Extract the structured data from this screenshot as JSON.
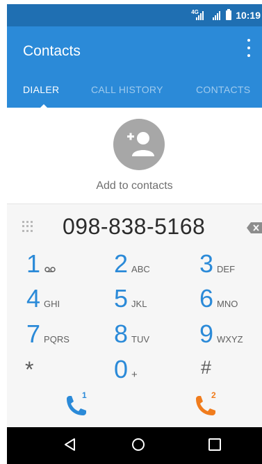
{
  "status_bar": {
    "network_label": "4G",
    "time": "10:19"
  },
  "app_bar": {
    "title": "Contacts",
    "menu_icon": "more-vert-icon"
  },
  "tabs": [
    {
      "label": "DIALER",
      "active": true
    },
    {
      "label": "CALL HISTORY",
      "active": false
    },
    {
      "label": "CONTACTS",
      "active": false
    }
  ],
  "add_contact": {
    "icon": "add-person-icon",
    "label": "Add to contacts"
  },
  "dialer": {
    "number": "098-838-5168",
    "keys": [
      {
        "digit": "1",
        "letters": "voicemail"
      },
      {
        "digit": "2",
        "letters": "ABC"
      },
      {
        "digit": "3",
        "letters": "DEF"
      },
      {
        "digit": "4",
        "letters": "GHI"
      },
      {
        "digit": "5",
        "letters": "JKL"
      },
      {
        "digit": "6",
        "letters": "MNO"
      },
      {
        "digit": "7",
        "letters": "PQRS"
      },
      {
        "digit": "8",
        "letters": "TUV"
      },
      {
        "digit": "9",
        "letters": "WXYZ"
      },
      {
        "digit": "*",
        "letters": ""
      },
      {
        "digit": "0",
        "letters": "+"
      },
      {
        "digit": "#",
        "letters": ""
      }
    ],
    "call_sim1_label": "1",
    "call_sim2_label": "2"
  },
  "colors": {
    "status_bar": "#1f6fb2",
    "app_bar": "#2b8ad8",
    "sim1": "#2b8ad8",
    "sim2": "#f07c1d"
  }
}
